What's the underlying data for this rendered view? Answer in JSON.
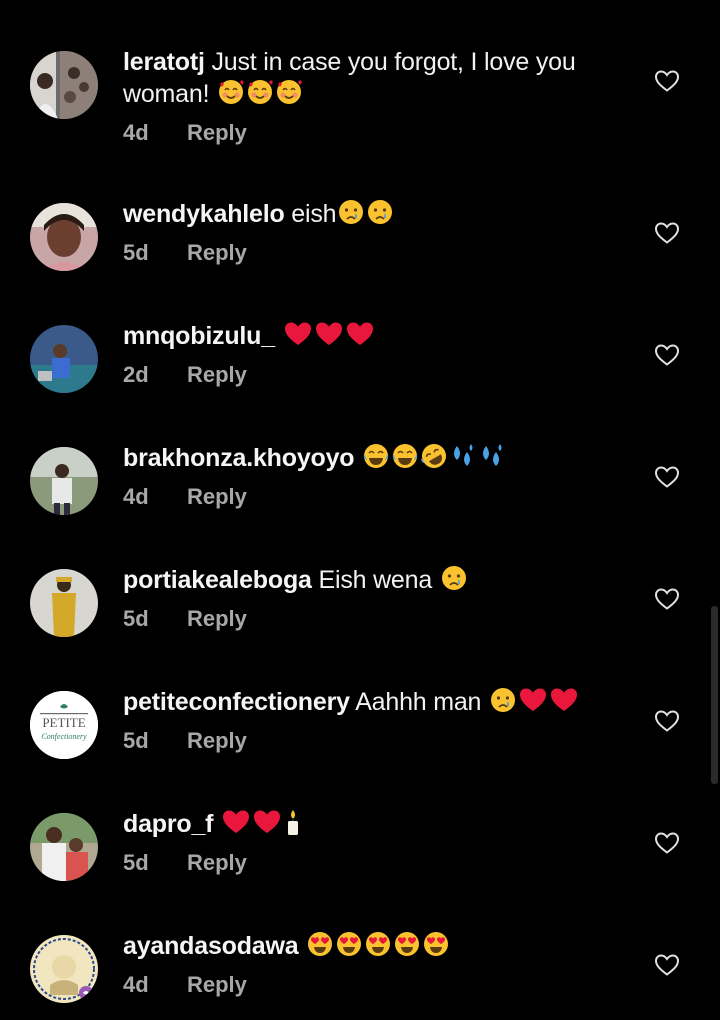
{
  "reply_label": "Reply",
  "comments": [
    {
      "username": "leratotj",
      "text": "Just in case you forgot, I love you woman!",
      "emojis": [
        "smiling-face-with-hearts-emoji",
        "smiling-face-with-hearts-emoji",
        "smiling-face-with-hearts-emoji"
      ],
      "time": "4d"
    },
    {
      "username": "wendykahlelo",
      "text": "eish",
      "emojis": [
        "crying-face-emoji",
        "crying-face-emoji"
      ],
      "time": "5d"
    },
    {
      "username": "mnqobizulu_",
      "text": "",
      "emojis": [
        "red-heart-emoji",
        "red-heart-emoji",
        "red-heart-emoji"
      ],
      "time": "2d"
    },
    {
      "username": "brakhonza.khoyoyo",
      "text": "",
      "emojis": [
        "tears-of-joy-emoji",
        "tears-of-joy-emoji",
        "rolling-laughing-emoji",
        "sweat-droplets-emoji",
        "sweat-droplets-emoji"
      ],
      "time": "4d"
    },
    {
      "username": "portiakealeboga",
      "text": "Eish wena",
      "emojis": [
        "crying-face-emoji"
      ],
      "time": "5d"
    },
    {
      "username": "petiteconfectionery",
      "text": "Aahhh man",
      "emojis": [
        "crying-face-emoji",
        "red-heart-emoji",
        "red-heart-emoji"
      ],
      "time": "5d"
    },
    {
      "username": "dapro_f",
      "text": "",
      "emojis": [
        "red-heart-emoji",
        "red-heart-emoji",
        "candle-emoji"
      ],
      "time": "5d"
    },
    {
      "username": "ayandasodawa",
      "text": "",
      "emojis": [
        "heart-eyes-emoji",
        "heart-eyes-emoji",
        "heart-eyes-emoji",
        "heart-eyes-emoji",
        "heart-eyes-emoji"
      ],
      "time": "4d"
    }
  ],
  "avatar_logo": {
    "line1": "PETITE",
    "line2": "Confectionery"
  },
  "colors": {
    "background": "#000000",
    "text": "#f5f5f5",
    "meta": "#a8a8a8",
    "heart": "#e8173b"
  }
}
